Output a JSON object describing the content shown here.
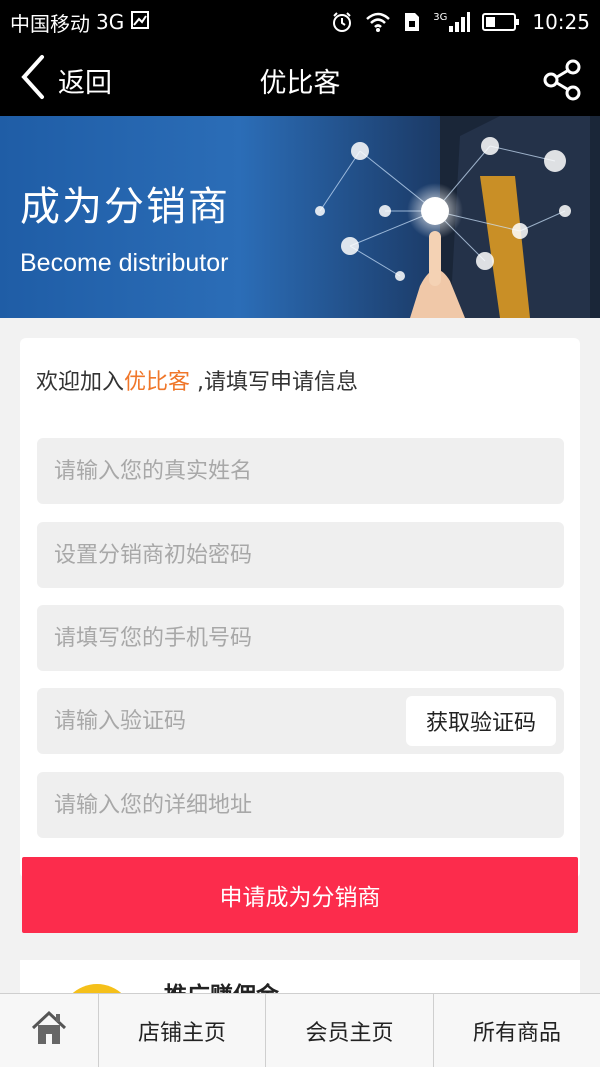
{
  "statusbar": {
    "carrier": "中国移动",
    "network": "3G",
    "signal_label": "3G",
    "time": "10:25"
  },
  "navbar": {
    "back_label": "返回",
    "title": "优比客"
  },
  "banner": {
    "title": "成为分销商",
    "subtitle": "Become distributor"
  },
  "form": {
    "welcome_prefix": "欢迎加入",
    "welcome_brand": "优比客",
    "welcome_suffix": " ,请填写申请信息",
    "name_placeholder": "请输入您的真实姓名",
    "name_value": "",
    "password_placeholder": "设置分销商初始密码",
    "password_value": "",
    "phone_placeholder": "请填写您的手机号码",
    "phone_value": "",
    "code_placeholder": "请输入验证码",
    "code_value": "",
    "get_code_label": "获取验证码",
    "address_placeholder": "请输入您的详细地址",
    "address_value": "",
    "submit_label": "申请成为分销商"
  },
  "promo": {
    "title": "推广赚佣金"
  },
  "tabbar": {
    "home_icon": "home-icon",
    "items": [
      "店铺主页",
      "会员主页",
      "所有商品"
    ]
  },
  "colors": {
    "accent_orange": "#f0772a",
    "submit_red": "#fc2c4c",
    "nav_black": "#000000"
  }
}
